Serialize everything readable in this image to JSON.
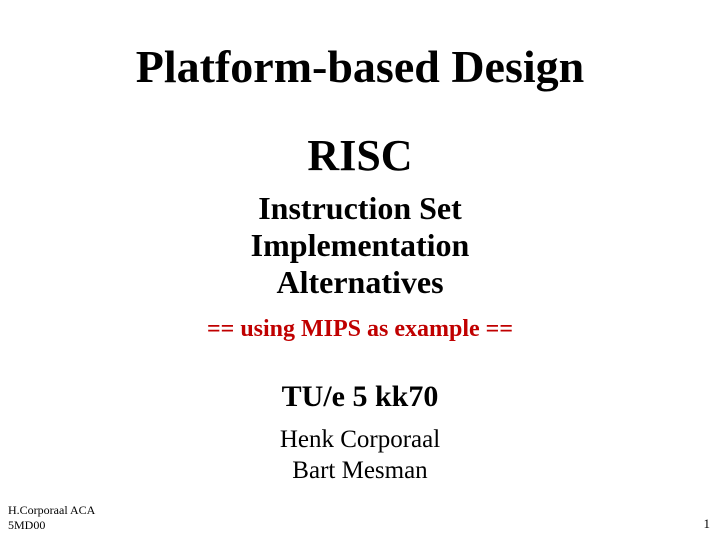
{
  "title": "Platform-based Design",
  "risc": "RISC",
  "subtitle_line1": "Instruction Set",
  "subtitle_line2": "Implementation",
  "subtitle_line3": "Alternatives",
  "example": "==  using MIPS as example  ==",
  "course": "TU/e   5 kk70",
  "author1": "Henk Corporaal",
  "author2": "Bart Mesman",
  "footer_left_line1": "H.Corporaal  ACA",
  "footer_left_line2": "5MD00",
  "page_number": "1"
}
